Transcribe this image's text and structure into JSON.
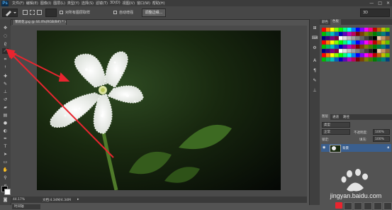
{
  "app": {
    "logo": "Ps"
  },
  "menubar": {
    "items": [
      "文件(F)",
      "编辑(E)",
      "图像(I)",
      "图层(L)",
      "类型(Y)",
      "选择(S)",
      "滤镜(T)",
      "3D(D)",
      "视图(V)",
      "窗口(W)",
      "帮助(H)"
    ],
    "window_controls": [
      "—",
      "□",
      "✕"
    ]
  },
  "options": {
    "sample_all_layers": "对所有图层取样",
    "auto_enhance": "自动增强",
    "refine_edge": "调整边缘...",
    "workspace_value": "3D"
  },
  "document": {
    "tab_title": "茉莉花.jpg @ 44.4%(RGB/8#) * ×",
    "zoom": "44.17%",
    "doc_info": "文档:4.34M/4.34M",
    "bottom_tab": "时间轴"
  },
  "panels": {
    "swatch_tabs": [
      "颜色",
      "色板"
    ],
    "layer_tabs": [
      "图层",
      "通道",
      "路径"
    ],
    "kind_filter": "类型",
    "blend_mode": "正常",
    "opacity_label": "不透明度:",
    "opacity_value": "100%",
    "lock_label": "锁定:",
    "fill_label": "填充:",
    "fill_value": "100%",
    "layer_name": "背景"
  },
  "watermark": {
    "text": "jingyan.baidu.com"
  },
  "colors": {
    "accent": "#3a5f8f",
    "arrow": "#e8252f",
    "chrome": "#474747"
  }
}
